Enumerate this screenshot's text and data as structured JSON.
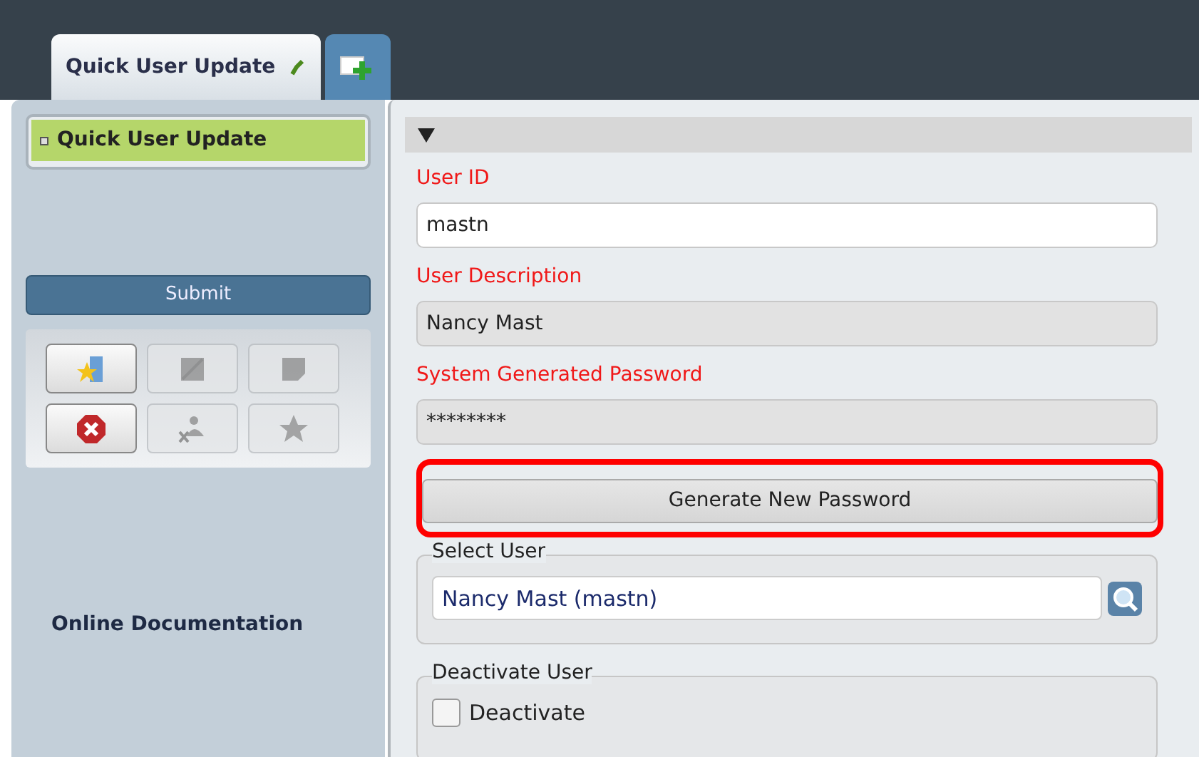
{
  "tabs": [
    {
      "label": "Quick User Update",
      "selected": true
    },
    {
      "kind": "new-tab",
      "selected": false
    }
  ],
  "sidebar": {
    "items": [
      {
        "label": "Quick User Update",
        "selected": true
      }
    ],
    "submit_button": "Submit",
    "toolbar": [
      {
        "kind": "add",
        "disabled": false
      },
      {
        "kind": "edit",
        "disabled": true
      },
      {
        "kind": "note",
        "disabled": true
      },
      {
        "kind": "delete",
        "disabled": false
      },
      {
        "kind": "remove-user",
        "disabled": true
      },
      {
        "kind": "favorite",
        "disabled": true
      }
    ],
    "link": "Online Documentation"
  },
  "form": {
    "expanded": true,
    "fields": [
      {
        "label": "User ID",
        "value": "mastn",
        "required": true,
        "readonly": false
      },
      {
        "label": "User Description",
        "value": "Nancy Mast",
        "required": true,
        "readonly": true
      },
      {
        "label": "System Generated Password",
        "value": "********",
        "required": true,
        "readonly": true
      }
    ],
    "generate_button": {
      "label": "Generate New Password",
      "highlighted": true
    },
    "select_user": {
      "legend": "Select User",
      "value": "Nancy Mast (mastn)"
    },
    "deactivate": {
      "legend": "Deactivate User",
      "label": "Deactivate",
      "checked": false
    }
  }
}
